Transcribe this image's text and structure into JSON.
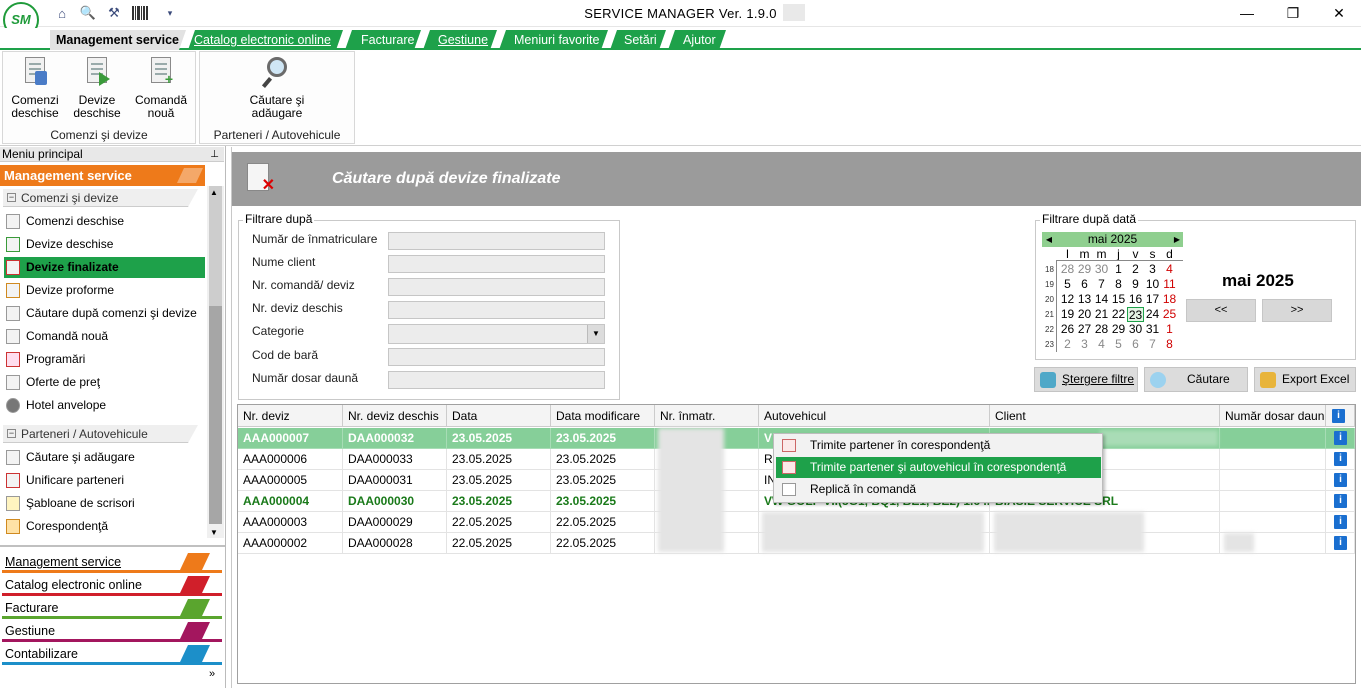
{
  "window": {
    "title": "SERVICE MANAGER Ver. 1.9.0",
    "logo_text": "SM",
    "quick_icons": [
      "home-icon",
      "search-doc-icon",
      "tools-icon",
      "barcode-icon",
      "dropdown-arrow-icon"
    ],
    "controls": {
      "minimize": "—",
      "restore": "❐",
      "close": "✕"
    }
  },
  "menu_tabs": [
    {
      "label": "Management service",
      "active": true
    },
    {
      "label": "Catalog electronic online",
      "active": false
    },
    {
      "label": "Facturare",
      "active": false
    },
    {
      "label": "Gestiune",
      "active": false
    },
    {
      "label": "Meniuri favorite",
      "active": false
    },
    {
      "label": "Setări",
      "active": false
    },
    {
      "label": "Ajutor",
      "active": false
    }
  ],
  "ribbon": {
    "groups": [
      {
        "title": "Comenzi şi devize",
        "buttons": [
          "Comenzi deschise",
          "Devize deschise",
          "Comandă nouă"
        ]
      },
      {
        "title": "Parteneri / Autovehicule",
        "buttons": [
          "Căutare şi adăugare"
        ]
      }
    ]
  },
  "sidebar": {
    "header": "Meniu principal",
    "pin": "⊥",
    "section_title": "Management service",
    "groups": [
      {
        "label": "Comenzi şi devize",
        "items": [
          "Comenzi deschise",
          "Devize deschise",
          "Devize finalizate",
          "Devize proforme",
          "Căutare după comenzi şi devize",
          "Comandă nouă",
          "Programări",
          "Oferte de preţ",
          "Hotel anvelope"
        ]
      },
      {
        "label": "Parteneri / Autovehicule",
        "items": [
          "Căutare şi adăugare",
          "Unificare parteneri",
          "Şabloane de scrisori",
          "Corespondenţă"
        ]
      }
    ],
    "selected_item": "Devize finalizate",
    "modules": [
      {
        "label": "Management service",
        "color": "#ee7a1a"
      },
      {
        "label": "Catalog electronic online",
        "color": "#d01f2a"
      },
      {
        "label": "Facturare",
        "color": "#5aa52e"
      },
      {
        "label": "Gestiune",
        "color": "#a3165e"
      },
      {
        "label": "Contabilizare",
        "color": "#1c8fc9"
      }
    ],
    "more": "»"
  },
  "panel": {
    "title": "Căutare după devize finalizate",
    "filter_title": "Filtrare după",
    "filters": [
      "Număr de înmatriculare",
      "Nume client",
      "Nr. comandă/ deviz",
      "Nr. deviz deschis",
      "Categorie",
      "Cod de bară",
      "Număr dosar daună"
    ],
    "date_filter_title": "Filtrare după dată",
    "calendar": {
      "month": "mai 2025",
      "weekdays": [
        "l",
        "m",
        "m",
        "j",
        "v",
        "s",
        "d"
      ],
      "weeks": [
        {
          "wk": "18",
          "days": [
            "28",
            "29",
            "30",
            "1",
            "2",
            "3",
            "4"
          ]
        },
        {
          "wk": "19",
          "days": [
            "5",
            "6",
            "7",
            "8",
            "9",
            "10",
            "11"
          ]
        },
        {
          "wk": "20",
          "days": [
            "12",
            "13",
            "14",
            "15",
            "16",
            "17",
            "18"
          ]
        },
        {
          "wk": "21",
          "days": [
            "19",
            "20",
            "21",
            "22",
            "23",
            "24",
            "25"
          ]
        },
        {
          "wk": "22",
          "days": [
            "26",
            "27",
            "28",
            "29",
            "30",
            "31",
            "1"
          ]
        },
        {
          "wk": "23",
          "days": [
            "2",
            "3",
            "4",
            "5",
            "6",
            "7",
            "8"
          ]
        }
      ],
      "today": "23"
    },
    "big_month": "mai 2025",
    "prev_btn": "<<",
    "next_btn": ">>",
    "actions": [
      "Ştergere filtre",
      "Căutare",
      "Export Excel"
    ]
  },
  "grid": {
    "columns": [
      "Nr. deviz",
      "Nr. deviz deschis",
      "Data",
      "Data modificare",
      "Nr. înmatr.",
      "Autovehicul",
      "Client",
      "Număr dosar daun"
    ],
    "rows": [
      {
        "nr": "AAA000007",
        "deschis": "DAA000032",
        "data": "23.05.2025",
        "mod": "23.05.2025",
        "auto": "V",
        "client": "",
        "state": "sel"
      },
      {
        "nr": "AAA000006",
        "deschis": "DAA000033",
        "data": "23.05.2025",
        "mod": "23.05.2025",
        "auto": "R",
        "client": "",
        "state": ""
      },
      {
        "nr": "AAA000005",
        "deschis": "DAA000031",
        "data": "23.05.2025",
        "mod": "23.05.2025",
        "auto": "IN",
        "client": "",
        "state": ""
      },
      {
        "nr": "AAA000004",
        "deschis": "DAA000030",
        "data": "23.05.2025",
        "mod": "23.05.2025",
        "auto": "VW GOLF VII(5G1, BQ1, BE1, BE2) 1.6 ...",
        "client": "BIASIE SERVICE SRL",
        "state": "bold"
      },
      {
        "nr": "AAA000003",
        "deschis": "DAA000029",
        "data": "22.05.2025",
        "mod": "22.05.2025",
        "auto": "",
        "client": "",
        "state": ""
      },
      {
        "nr": "AAA000002",
        "deschis": "DAA000028",
        "data": "22.05.2025",
        "mod": "22.05.2025",
        "auto": "",
        "client": "",
        "state": ""
      }
    ]
  },
  "context_menu": {
    "items": [
      "Trimite partener în corespondenţă",
      "Trimite partener şi autovehicul în corespondenţă",
      "Replică în comandă"
    ],
    "highlighted": 1
  }
}
